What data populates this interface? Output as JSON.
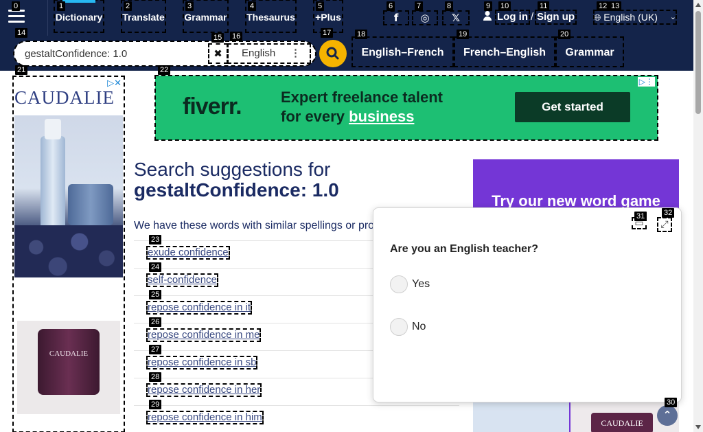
{
  "badges": [
    "0",
    "1",
    "2",
    "3",
    "4",
    "5",
    "6",
    "7",
    "8",
    "9",
    "10",
    "11",
    "12",
    "13",
    "14",
    "15",
    "16",
    "17",
    "18",
    "19",
    "20",
    "21",
    "22",
    "23",
    "24",
    "25",
    "26",
    "27",
    "28",
    "29",
    "30",
    "31",
    "32"
  ],
  "nav": {
    "dictionary": "Dictionary",
    "translate": "Translate",
    "grammar": "Grammar",
    "thesaurus": "Thesaurus",
    "plus": "+Plus"
  },
  "social": {
    "facebook": "f",
    "instagram": "◎",
    "x": "𝕏"
  },
  "account": {
    "login": "Log in",
    "separator": "/",
    "signup": "Sign up"
  },
  "language": {
    "label": "English (UK)"
  },
  "search": {
    "value": "gestaltConfidence: 1.0",
    "clear": "✖",
    "language": "English",
    "menu": "⋮"
  },
  "tabs": {
    "en_fr": "English–French",
    "fr_en": "French–English",
    "grammar": "Grammar"
  },
  "ads": {
    "caudalie": "CAUDALIE",
    "caudalie_product": "CAUDALIE",
    "adchoices": "▷✕",
    "fiverr_logo": "fiverr.",
    "fiverr_line1": "Expert freelance talent",
    "fiverr_line2_prefix": "for every ",
    "fiverr_line2_highlight": "business",
    "fiverr_cta": "Get started",
    "fiverr_icons": "▷⋮",
    "word_game": "Try our new word game",
    "right_product_label": "CAUDALIE"
  },
  "main": {
    "heading_prefix": "Search suggestions for",
    "heading_term": "gestaltConfidence: 1.0",
    "intro": "We have these words with similar spellings or pro",
    "suggestions": [
      "exude confidence",
      "self-confidence",
      "repose confidence in it",
      "repose confidence in me",
      "repose confidence in sb",
      "repose confidence in her",
      "repose confidence in him"
    ]
  },
  "popup": {
    "question": "Are you an English teacher?",
    "yes": "Yes",
    "no": "No",
    "minimize": "▭",
    "expand": "⤢"
  },
  "scroll_top": "⌃"
}
